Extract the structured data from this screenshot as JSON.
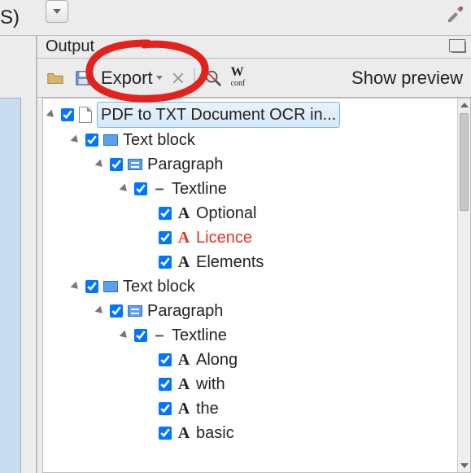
{
  "topfrag": {
    "paren": "S)"
  },
  "panel": {
    "title": "Output"
  },
  "toolbar": {
    "export_label": "Export",
    "show_preview_label": "Show preview"
  },
  "tree": {
    "root": {
      "label": "PDF to TXT Document OCR in...",
      "checked": true
    },
    "blocks": [
      {
        "label": "Text block",
        "checked": true,
        "paragraph": {
          "label": "Paragraph",
          "checked": true,
          "textline": {
            "label": "Textline",
            "checked": true,
            "words": [
              {
                "label": "Optional",
                "checked": true,
                "flag": ""
              },
              {
                "label": "Licence",
                "checked": true,
                "flag": "red"
              },
              {
                "label": "Elements",
                "checked": true,
                "flag": ""
              }
            ]
          }
        }
      },
      {
        "label": "Text block",
        "checked": true,
        "paragraph": {
          "label": "Paragraph",
          "checked": true,
          "textline": {
            "label": "Textline",
            "checked": true,
            "words": [
              {
                "label": "Along",
                "checked": true,
                "flag": ""
              },
              {
                "label": "with",
                "checked": true,
                "flag": ""
              },
              {
                "label": "the",
                "checked": true,
                "flag": ""
              },
              {
                "label": "basic",
                "checked": true,
                "flag": ""
              }
            ]
          }
        }
      }
    ]
  }
}
